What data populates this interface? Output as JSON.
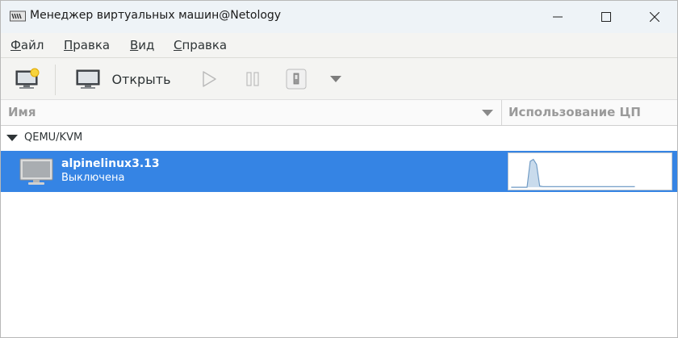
{
  "window": {
    "title": "Менеджер виртуальных машин@Netology",
    "app_icon": "virt-manager-icon"
  },
  "menu": {
    "items": [
      {
        "mnemonic": "Ф",
        "rest": "айл"
      },
      {
        "mnemonic": "П",
        "rest": "равка"
      },
      {
        "mnemonic": "В",
        "rest": "ид"
      },
      {
        "mnemonic": "С",
        "rest": "правка"
      }
    ]
  },
  "toolbar": {
    "open_label": "Открыть",
    "icons": [
      "new-vm-icon",
      "monitor-icon",
      "play-icon",
      "pause-icon",
      "shutdown-icon",
      "chevron-down-icon"
    ]
  },
  "columns": {
    "name": "Имя",
    "cpu": "Использование ЦП"
  },
  "group": {
    "label": "QEMU/KVM"
  },
  "vms": [
    {
      "name": "alpinelinux3.13",
      "status": "Выключена",
      "selected": true,
      "cpu_usage_history": [
        0,
        0,
        0,
        0,
        0,
        0,
        82,
        88,
        72,
        4,
        2,
        2,
        2,
        2,
        2,
        2,
        2,
        2,
        2,
        2,
        2,
        2,
        2,
        2,
        2,
        2,
        2,
        2,
        2,
        2,
        2,
        2,
        2,
        2,
        2,
        2,
        2,
        2,
        2,
        2
      ]
    }
  ],
  "colors": {
    "selection": "#3584e4",
    "graph_fill": "#c9dbec",
    "graph_line": "#6f9ac4"
  }
}
